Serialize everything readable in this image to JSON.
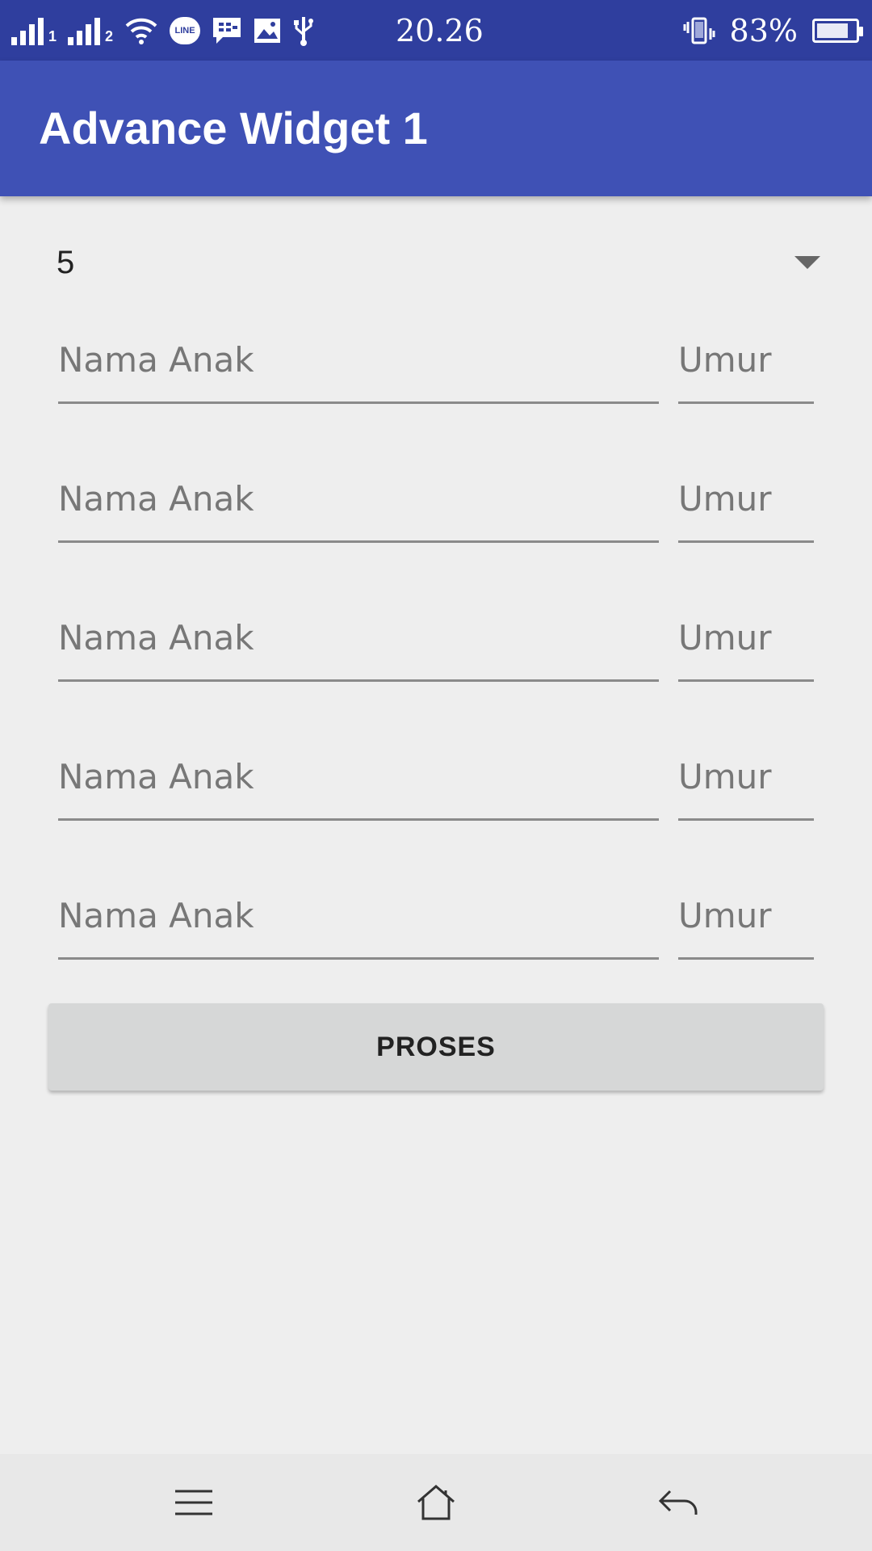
{
  "status_bar": {
    "time": "20.26",
    "battery_percent": "83%",
    "battery_level": 0.83,
    "icons": [
      "signal-sim1-icon",
      "signal-sim2-icon",
      "wifi-icon",
      "line-app-icon",
      "bbm-icon",
      "gallery-icon",
      "usb-icon",
      "vibrate-icon",
      "battery-icon"
    ],
    "sim1_label": "1",
    "sim2_label": "2",
    "line_label": "LINE"
  },
  "app_bar": {
    "title": "Advance Widget 1",
    "color": "#3f51b5"
  },
  "spinner": {
    "selected": "5"
  },
  "children": [
    {
      "name_placeholder": "Nama Anak",
      "age_placeholder": "Umur"
    },
    {
      "name_placeholder": "Nama Anak",
      "age_placeholder": "Umur"
    },
    {
      "name_placeholder": "Nama Anak",
      "age_placeholder": "Umur"
    },
    {
      "name_placeholder": "Nama Anak",
      "age_placeholder": "Umur"
    },
    {
      "name_placeholder": "Nama Anak",
      "age_placeholder": "Umur"
    }
  ],
  "proses_button": {
    "label": "PROSES"
  },
  "nav_bar": {
    "icons": [
      "menu-icon",
      "home-icon",
      "back-icon"
    ]
  }
}
